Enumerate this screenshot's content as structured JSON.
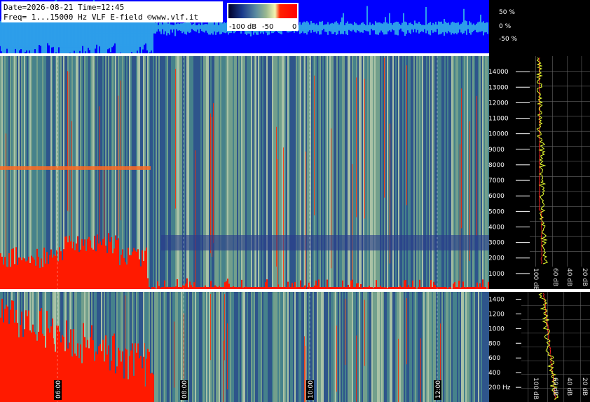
{
  "header": {
    "date_line": "Date=2026-08-21 Time=12:45",
    "freq_line": "Freq= 1...15000 Hz   VLF E-field ©www.vlf.it"
  },
  "colorbar": {
    "labels": [
      "-100 dB",
      "-50",
      "0"
    ],
    "colors": [
      "#00003a",
      "#1a3a8c",
      "#5a8aa0",
      "#8ab090",
      "#f0f0a0",
      "#ff2000",
      "#ff0000"
    ]
  },
  "colors": {
    "waveform_bg": "#0000ff",
    "waveform_line": "#40e0e0",
    "spectrum_trace": "#e8ff30",
    "spectrum_avg": "#ff2020",
    "hot": "#ff1a00"
  },
  "chart_data": [
    {
      "type": "line",
      "name": "waveform-panel",
      "ylabel_ticks": [
        "50 %",
        "0 %",
        "-50 %"
      ],
      "y_values": [
        50,
        0,
        -50
      ]
    },
    {
      "type": "heatmap",
      "name": "spectrogram-upper",
      "y_ticks": [
        "14000",
        "13000",
        "12000",
        "11000",
        "10000",
        "9000",
        "8000",
        "7000",
        "6000",
        "5000",
        "4000",
        "3000",
        "2000",
        "1000"
      ],
      "ylim": [
        0,
        15000
      ]
    },
    {
      "type": "heatmap",
      "name": "spectrogram-lower",
      "y_ticks": [
        "1400",
        "1200",
        "1000",
        "800",
        "600",
        "400",
        "200 Hz"
      ],
      "ylim": [
        0,
        1500
      ],
      "x_ticks": [
        "06:00",
        "08:00",
        "10:00",
        "12:00"
      ]
    },
    {
      "type": "line",
      "name": "spectrum-upper",
      "db_ticks": [
        "100 dB",
        "60 dB",
        "40 dB",
        "20 dB"
      ]
    },
    {
      "type": "line",
      "name": "spectrum-lower",
      "db_ticks": [
        "100 dB",
        "60 dB",
        "40 dB",
        "20 dB"
      ]
    }
  ]
}
